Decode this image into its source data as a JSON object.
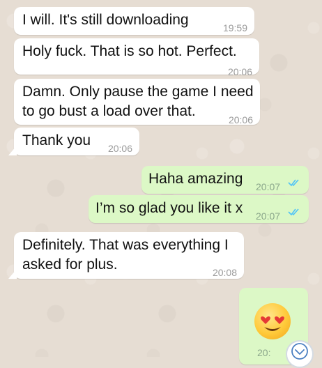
{
  "chat": {
    "messages": [
      {
        "text": "I will. It's still downloading",
        "time": "19:59",
        "direction": "incoming"
      },
      {
        "text": "Holy fuck. That is so hot. Perfect.",
        "time": "20:06",
        "direction": "incoming"
      },
      {
        "text_line1": "Damn. Only pause the game I need",
        "text_line2": "to go bust a load over that.",
        "time": "20:06",
        "direction": "incoming"
      },
      {
        "text": "Thank you",
        "time": "20:06",
        "direction": "incoming"
      },
      {
        "text": "Haha amazing",
        "time": "20:07",
        "direction": "outgoing",
        "status": "read"
      },
      {
        "text": "I’m so glad you like it x",
        "time": "20:07",
        "direction": "outgoing",
        "status": "read"
      },
      {
        "text_line1": "Definitely. That was everything I",
        "text_line2": "asked for plus.",
        "time": "20:08",
        "direction": "incoming"
      },
      {
        "emoji": "heart-eyes-emoji",
        "time": "20:",
        "direction": "outgoing"
      }
    ]
  },
  "colors": {
    "incoming_bubble": "#ffffff",
    "outgoing_bubble": "#dcf8c6",
    "read_check": "#4fc3f7",
    "wallpaper": "#e6ddd3"
  },
  "icons": {
    "read_receipt": "double-check-icon",
    "scroll_down": "chevron-down-icon"
  }
}
